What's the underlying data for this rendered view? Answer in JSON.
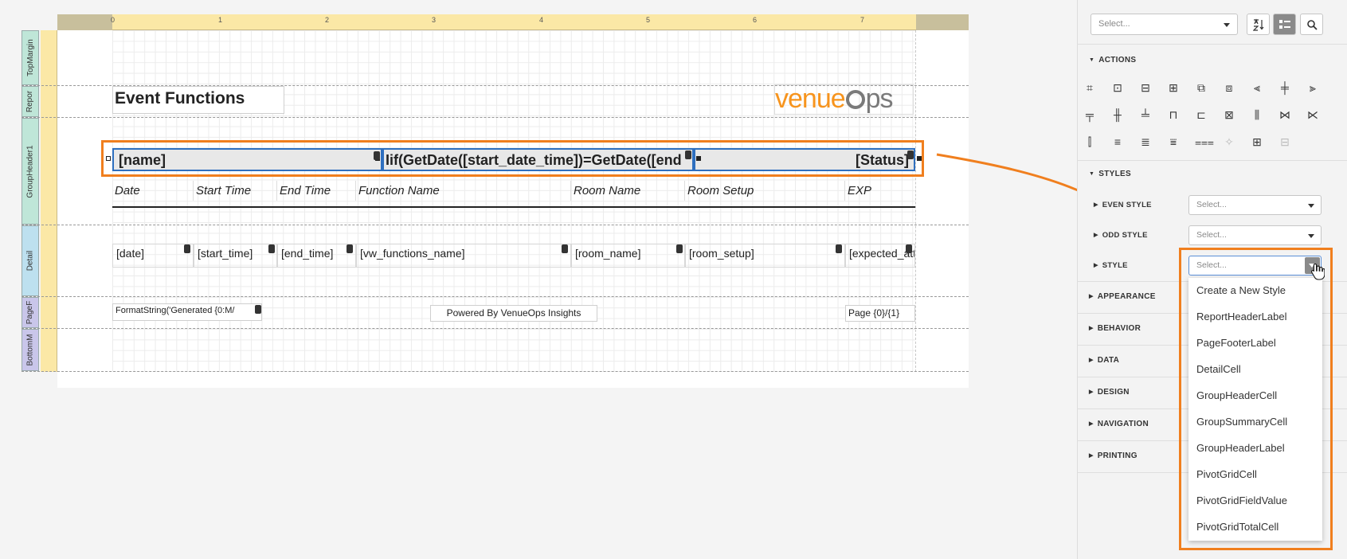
{
  "ruler": {
    "ticks": [
      "0",
      "1",
      "2",
      "3",
      "4",
      "5",
      "6",
      "7"
    ]
  },
  "bands": {
    "top_margin": "TopMargin",
    "report_header": "Repor",
    "group_header": "GroupHeader1",
    "detail": "Detail",
    "page_footer": "PageF",
    "bottom_margin": "BottomM"
  },
  "report": {
    "title": "Event Functions",
    "logo_text_a": "venue",
    "logo_text_b": "ps",
    "group": {
      "name": "[name]",
      "date_expr": "Iif(GetDate([start_date_time])=GetDate([end",
      "status": "[Status]"
    },
    "columns": [
      {
        "label": "Date",
        "field": "[date]"
      },
      {
        "label": "Start Time",
        "field": "[start_time]"
      },
      {
        "label": "End Time",
        "field": "[end_time]"
      },
      {
        "label": "Function Name",
        "field": "[vw_functions_name]"
      },
      {
        "label": "Room Name",
        "field": "[room_name]"
      },
      {
        "label": "Room Setup",
        "field": "[room_setup]"
      },
      {
        "label": "EXP",
        "field": "[expected_attendance]"
      }
    ],
    "footer": {
      "generated": "FormatString('Generated {0:M/",
      "powered": "Powered By VenueOps Insights",
      "page": "Page {0}/{1}"
    }
  },
  "panel": {
    "search_select": "Select...",
    "sections": {
      "actions": "ACTIONS",
      "styles": "STYLES",
      "appearance": "APPEARANCE",
      "behavior": "BEHAVIOR",
      "data": "DATA",
      "design": "DESIGN",
      "navigation": "NAVIGATION",
      "printing": "PRINTING"
    },
    "style_rows": [
      {
        "label": "EVEN STYLE",
        "value": "Select..."
      },
      {
        "label": "ODD STYLE",
        "value": "Select..."
      },
      {
        "label": "STYLE",
        "value": "Select..."
      }
    ],
    "dropdown": [
      "Create a New Style",
      "ReportHeaderLabel",
      "PageFooterLabel",
      "DetailCell",
      "GroupHeaderCell",
      "GroupSummaryCell",
      "GroupHeaderLabel",
      "PivotGridCell",
      "PivotGridFieldValue",
      "PivotGridTotalCell"
    ],
    "icons": {
      "sort_alpha": "sort-alpha-icon",
      "categorized": "categorized-icon",
      "search": "search-icon"
    }
  },
  "colors": {
    "highlight": "#f07f1e",
    "selection": "#2e6fbf",
    "logo_orange": "#f7941d",
    "logo_gray": "#7a7a7a"
  }
}
